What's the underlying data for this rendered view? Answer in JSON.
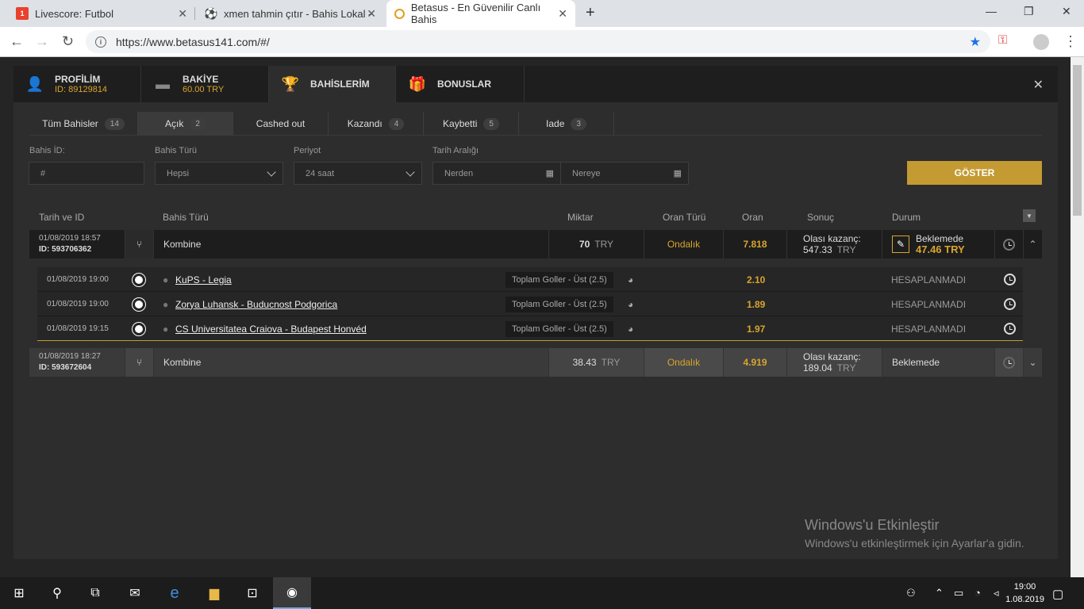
{
  "browser": {
    "tabs": [
      {
        "title": "Livescore: Futbol",
        "icon": "livescore-icon"
      },
      {
        "title": "xmen tahmin çıtır - Bahis Lokal -",
        "icon": "soccer-ball-icon"
      },
      {
        "title": "Betasus - En Güvenilir Canlı Bahis",
        "icon": "betasus-icon"
      }
    ],
    "url": "https://www.betasus141.com/#/"
  },
  "modal": {
    "tabs": [
      {
        "label": "PROFİLİM",
        "sub": "ID: 89129814"
      },
      {
        "label": "BAKİYE",
        "sub": "60.00 TRY"
      },
      {
        "label": "BAHİSLERİM",
        "sub": ""
      },
      {
        "label": "BONUSLAR",
        "sub": ""
      }
    ],
    "filter_tabs": [
      {
        "label": "Tüm Bahisler",
        "count": "14"
      },
      {
        "label": "Açık",
        "count": "2"
      },
      {
        "label": "Cashed out",
        "count": ""
      },
      {
        "label": "Kazandı",
        "count": "4"
      },
      {
        "label": "Kaybetti",
        "count": "5"
      },
      {
        "label": "Iade",
        "count": "3"
      }
    ],
    "filters": {
      "bahis_id_label": "Bahis İD:",
      "bahis_id_placeholder": "#",
      "bahis_turu_label": "Bahis Türü",
      "bahis_turu_value": "Hepsi",
      "periyot_label": "Periyot",
      "periyot_value": "24 saat",
      "tarih_label": "Tarih Aralığı",
      "from_placeholder": "Nerden",
      "to_placeholder": "Nereye",
      "show_button": "GÖSTER"
    },
    "table_headers": {
      "date": "Tarih ve ID",
      "type": "Bahis Türü",
      "amount": "Miktar",
      "odds_type": "Oran Türü",
      "odds": "Oran",
      "result": "Sonuç",
      "status": "Durum"
    },
    "bets": [
      {
        "date": "01/08/2019 18:57",
        "id": "ID: 593706362",
        "type": "Kombine",
        "amount": "70",
        "currency": "TRY",
        "odds_type": "Ondalık",
        "odds": "7.818",
        "result_label": "Olası kazanç:",
        "result_value": "547.33",
        "result_currency": "TRY",
        "status": "Beklemede",
        "cashout": "47.46 TRY",
        "selections": [
          {
            "date": "01/08/2019 19:00",
            "match": "KuPS - Legia",
            "market": "Toplam Goller - Üst (2.5)",
            "odds": "2.10",
            "status": "HESAPLANMADI"
          },
          {
            "date": "01/08/2019 19:00",
            "match": "Zorya Luhansk - Buducnost Podgorica",
            "market": "Toplam Goller - Üst (2.5)",
            "odds": "1.89",
            "status": "HESAPLANMADI"
          },
          {
            "date": "01/08/2019 19:15",
            "match": "CS Universitatea Craiova - Budapest Honvéd",
            "market": "Toplam Goller - Üst (2.5)",
            "odds": "1.97",
            "status": "HESAPLANMADI"
          }
        ]
      },
      {
        "date": "01/08/2019 18:27",
        "id": "ID: 593672604",
        "type": "Kombine",
        "amount": "38.43",
        "currency": "TRY",
        "odds_type": "Ondalık",
        "odds": "4.919",
        "result_label": "Olası kazanç:",
        "result_value": "189.04",
        "result_currency": "TRY",
        "status": "Beklemede"
      }
    ]
  },
  "watermark": {
    "title": "Windows'u Etkinleştir",
    "subtitle": "Windows'u etkinleştirmek için Ayarlar'a gidin."
  },
  "taskbar": {
    "time": "19:00",
    "date": "1.08.2019"
  },
  "colors": {
    "accent": "#d9a52e",
    "button": "#c49a32"
  }
}
